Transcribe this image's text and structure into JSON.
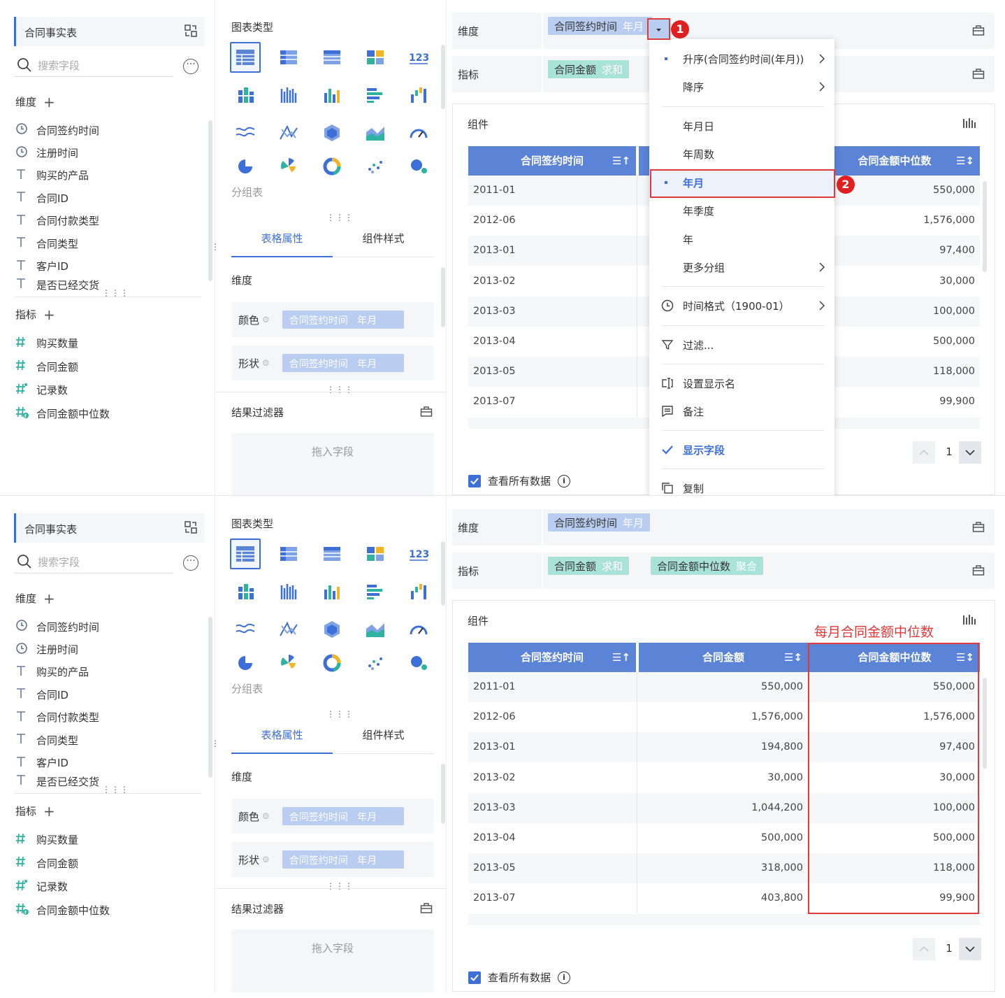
{
  "left": {
    "dataset_title": "合同事实表",
    "search_placeholder": "搜索字段",
    "dimension_header": "维度",
    "measure_header": "指标",
    "dimensions": [
      {
        "label": "合同签约时间",
        "icon": "clock-icon"
      },
      {
        "label": "注册时间",
        "icon": "clock-icon"
      },
      {
        "label": "购买的产品",
        "icon": "text-type-icon"
      },
      {
        "label": "合同ID",
        "icon": "text-type-icon"
      },
      {
        "label": "合同付款类型",
        "icon": "text-type-icon"
      },
      {
        "label": "合同类型",
        "icon": "text-type-icon"
      },
      {
        "label": "客户ID",
        "icon": "text-type-icon"
      },
      {
        "label": "是否已经交货",
        "icon": "text-type-icon"
      }
    ],
    "measures": [
      {
        "label": "购买数量",
        "icon": "number-icon"
      },
      {
        "label": "合同金额",
        "icon": "number-icon"
      },
      {
        "label": "记录数",
        "icon": "record-count-icon"
      },
      {
        "label": "合同金额中位数",
        "icon": "calculated-number-icon"
      }
    ]
  },
  "middle": {
    "chart_type_title": "图表类型",
    "chart_type_caption": "分组表",
    "chart_types": [
      "grouped-table-icon",
      "cross-table-icon",
      "detail-table-icon",
      "dashboard-table-icon",
      "kpi-number-icon",
      "stacked-column-icon",
      "multi-column-icon",
      "column-chart-icon",
      "bar-chart-icon",
      "waterfall-icon",
      "line-chart-icon",
      "radar-line-icon",
      "polygon-icon",
      "area-chart-icon",
      "gauge-icon",
      "pie-chart-icon",
      "rose-chart-icon",
      "donut-chart-icon",
      "scatter-icon",
      "bubble-icon"
    ],
    "tabs": [
      "表格属性",
      "组件样式"
    ],
    "dimension_label": "维度",
    "color_label": "颜色",
    "shape_label": "形状",
    "attr_pill": {
      "name": "合同签约时间",
      "agg": "年月"
    },
    "result_filter": "结果过滤器",
    "drop_placeholder": "拖入字段"
  },
  "right": {
    "dim_shelf_label": "维度",
    "measure_shelf_label": "指标",
    "dim_pill": {
      "name": "合同签约时间",
      "agg": "年月"
    },
    "measure_pills": [
      {
        "name": "合同金额",
        "agg": "求和"
      },
      {
        "name": "合同金额中位数",
        "agg": "聚合"
      }
    ],
    "component_label": "组件",
    "columns": [
      "合同签约时间",
      "合同金额",
      "合同金额中位数"
    ],
    "rows": [
      {
        "date": "2011-01",
        "amount": "550,000",
        "median": "550,000"
      },
      {
        "date": "2012-06",
        "amount": "1,576,000",
        "median": "1,576,000"
      },
      {
        "date": "2013-01",
        "amount": "194,800",
        "median": "97,400"
      },
      {
        "date": "2013-02",
        "amount": "30,000",
        "median": "30,000"
      },
      {
        "date": "2013-03",
        "amount": "1,044,200",
        "median": "100,000"
      },
      {
        "date": "2013-04",
        "amount": "500,000",
        "median": "500,000"
      },
      {
        "date": "2013-05",
        "amount": "318,000",
        "median": "118,000"
      },
      {
        "date": "2013-07",
        "amount": "403,800",
        "median": "99,900"
      }
    ],
    "page_number": "1",
    "view_all_label": "查看所有数据",
    "annotation": "每月合同金额中位数"
  },
  "menu": {
    "items": [
      {
        "label": "升序(合同签约时间(年月))",
        "bullet": true,
        "submenu": true
      },
      {
        "label": "降序",
        "submenu": true
      },
      {
        "label": "年月日"
      },
      {
        "label": "年周数"
      },
      {
        "label": "年月",
        "bullet": true,
        "selected": true
      },
      {
        "label": "年季度"
      },
      {
        "label": "年"
      },
      {
        "label": "更多分组",
        "submenu": true
      },
      {
        "label": "时间格式（1900-01）",
        "icon": "clock-icon",
        "submenu": true
      },
      {
        "label": "过滤...",
        "icon": "filter-icon"
      },
      {
        "label": "设置显示名",
        "icon": "rename-icon"
      },
      {
        "label": "备注",
        "icon": "note-icon"
      },
      {
        "label": "显示字段",
        "icon": "check-icon"
      },
      {
        "label": "复制",
        "icon": "copy-icon"
      }
    ],
    "badges": [
      "1",
      "2"
    ]
  },
  "colors": {
    "accent": "#3d6fd8",
    "header": "#5b84d6",
    "dim_pill": "#b8cdf0",
    "measure_pill": "#a9e3d8",
    "annotation": "#e03a3a"
  }
}
